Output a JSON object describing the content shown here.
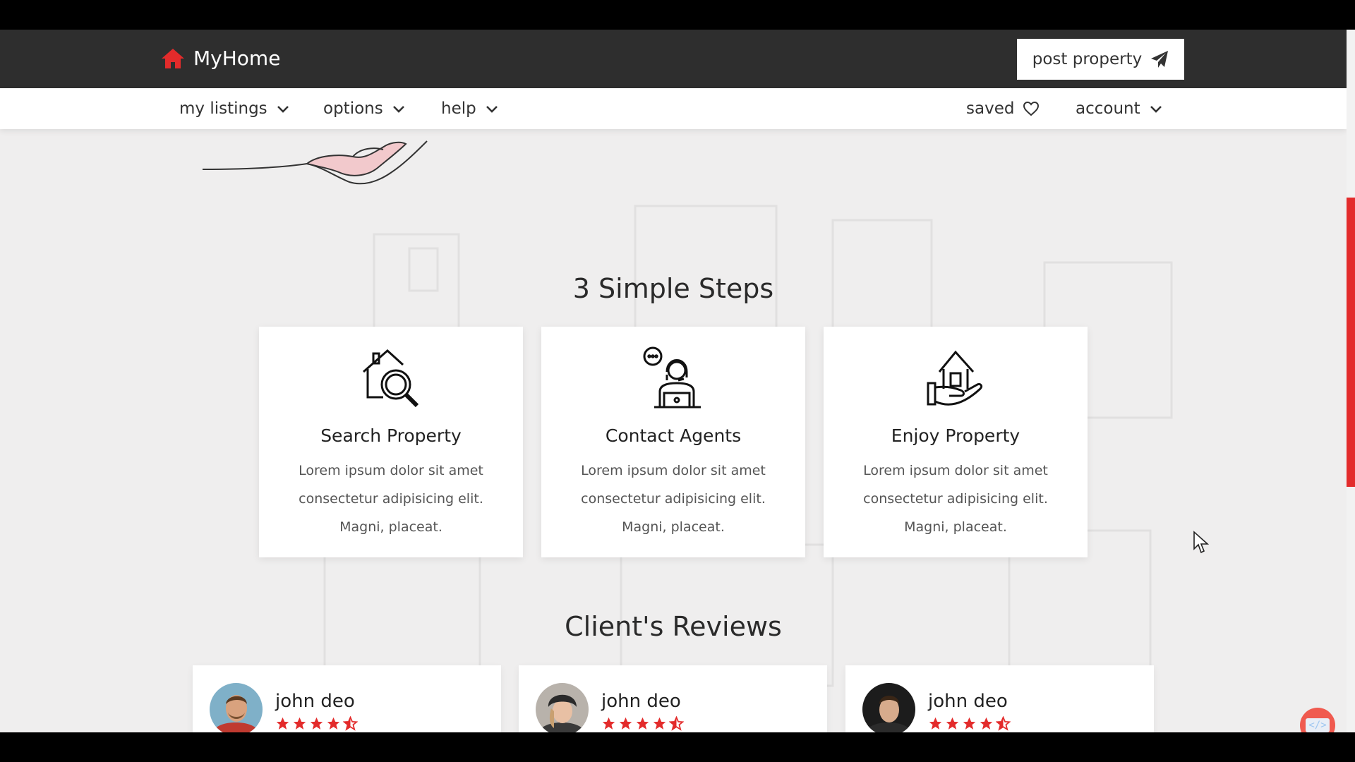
{
  "brand": {
    "name": "MyHome",
    "accent": "#e32b2b"
  },
  "header": {
    "post_label": "post property"
  },
  "nav": {
    "left": [
      {
        "label": "my listings"
      },
      {
        "label": "options"
      },
      {
        "label": "help"
      }
    ],
    "saved_label": "saved",
    "account_label": "account"
  },
  "steps": {
    "title": "3 Simple Steps",
    "cards": [
      {
        "title": "Search Property",
        "icon": "house-search-icon",
        "desc": "Lorem ipsum dolor sit amet consectetur adipisicing elit. Magni, placeat."
      },
      {
        "title": "Contact Agents",
        "icon": "agent-headset-icon",
        "desc": "Lorem ipsum dolor sit amet consectetur adipisicing elit. Magni, placeat."
      },
      {
        "title": "Enjoy Property",
        "icon": "house-in-hand-icon",
        "desc": "Lorem ipsum dolor sit amet consectetur adipisicing elit. Magni, placeat."
      }
    ]
  },
  "reviews": {
    "title": "Client's Reviews",
    "items": [
      {
        "name": "john deo",
        "rating": 4.5
      },
      {
        "name": "john deo",
        "rating": 4.5
      },
      {
        "name": "john deo",
        "rating": 4.5
      }
    ]
  },
  "code_badge": "</>"
}
